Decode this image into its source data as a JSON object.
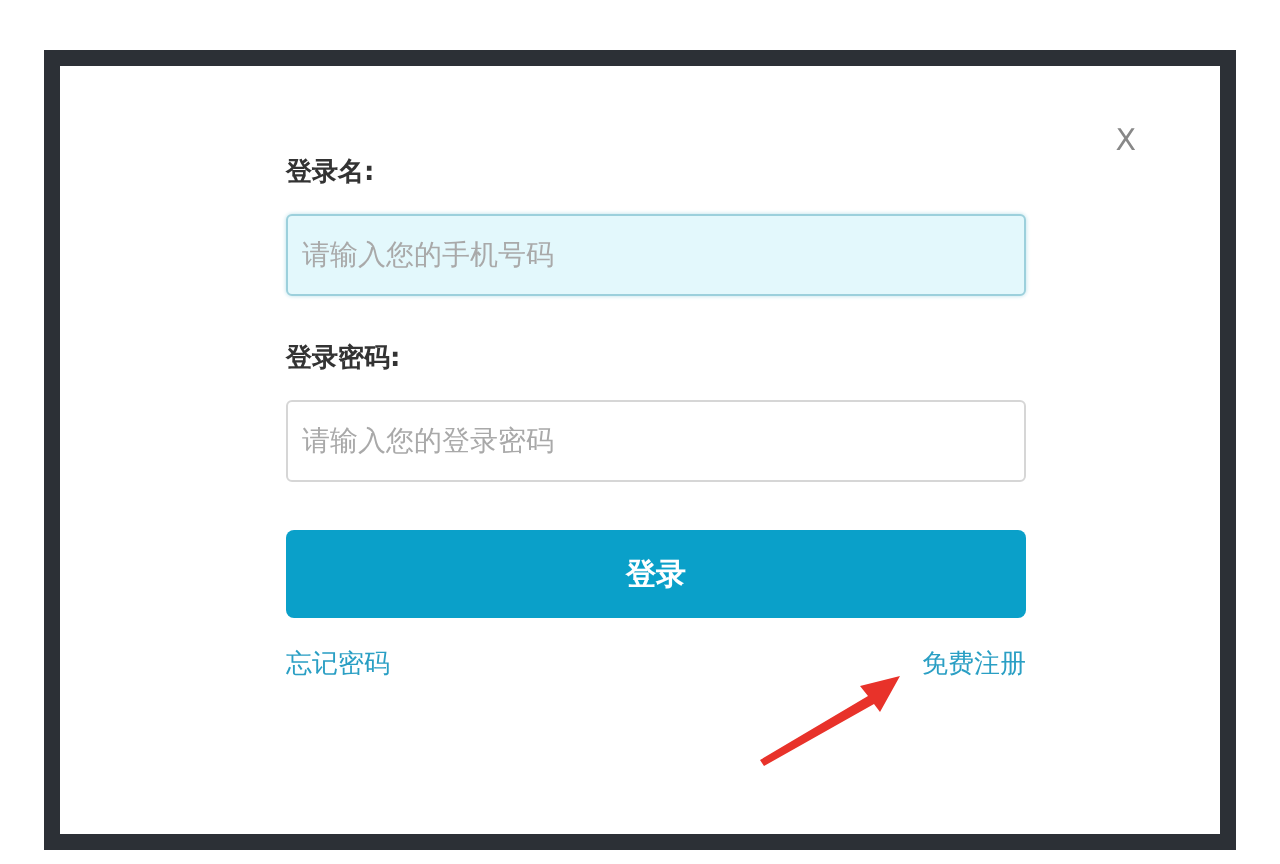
{
  "dialog": {
    "close": "X"
  },
  "fields": [
    {
      "label": "登录名:",
      "placeholder": "请输入您的手机号码",
      "focused": true
    },
    {
      "label": "登录密码:",
      "placeholder": "请输入您的登录密码",
      "focused": false
    }
  ],
  "submit": "登录",
  "links": [
    "忘记密码",
    "免费注册"
  ]
}
